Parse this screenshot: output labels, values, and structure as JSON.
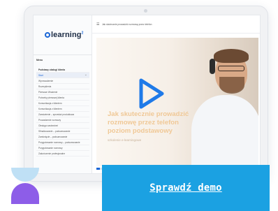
{
  "app": {
    "logo_text": "learning",
    "logo_suffix": "2"
  },
  "sidebar": {
    "heading": "Menu",
    "items": [
      {
        "label": "Podstawy obsługi klienta",
        "state": "header"
      },
      {
        "label": "Start",
        "state": "active"
      },
      {
        "label": "Wprowadzenie",
        "state": "normal"
      },
      {
        "label": "Rozmyślenia",
        "state": "normal"
      },
      {
        "label": "Pierwsze Wrażenie",
        "state": "normal"
      },
      {
        "label": "Potrzeby pierwszej klienta",
        "state": "normal"
      },
      {
        "label": "Komunikacja z klientem",
        "state": "normal"
      },
      {
        "label": "Komunikacja z klientem",
        "state": "normal"
      },
      {
        "label": "Zamówienie – sprzedaż produktowa",
        "state": "normal"
      },
      {
        "label": "Prowadzenie rozmowy",
        "state": "normal"
      },
      {
        "label": "Obsługa zastrzeżeń",
        "state": "normal"
      },
      {
        "label": "Sfinalizowanie – podsumowanie",
        "state": "normal"
      },
      {
        "label": "Zamknięcie – podsumowanie",
        "state": "normal"
      },
      {
        "label": "Przygotowanie rozmowy – podsumowanie",
        "state": "normal"
      },
      {
        "label": "Przygotowanie rozmowy",
        "state": "normal"
      },
      {
        "label": "Zakończenie profesjonalne",
        "state": "normal"
      }
    ]
  },
  "topbar": {
    "course_title": "Jak skutecznie prowadzić rozmowę przez telefon"
  },
  "video": {
    "title_lines": [
      "Jak skutecznie prowadzić",
      "rozmowę przez telefon",
      "poziom podstawowy"
    ],
    "subtitle": "szkolenie e-learningowe",
    "progress": 0.02
  },
  "cta": {
    "label": "Sprawdź demo"
  },
  "colors": {
    "accent": "#1ba1e2",
    "brand_blue": "#1a66d6",
    "play_blue": "#1f7ae8",
    "shape_light": "#bfe0f5",
    "shape_purple": "#8d5de8"
  },
  "icons": {
    "play": "play-icon",
    "menu": "hamburger-icon"
  }
}
